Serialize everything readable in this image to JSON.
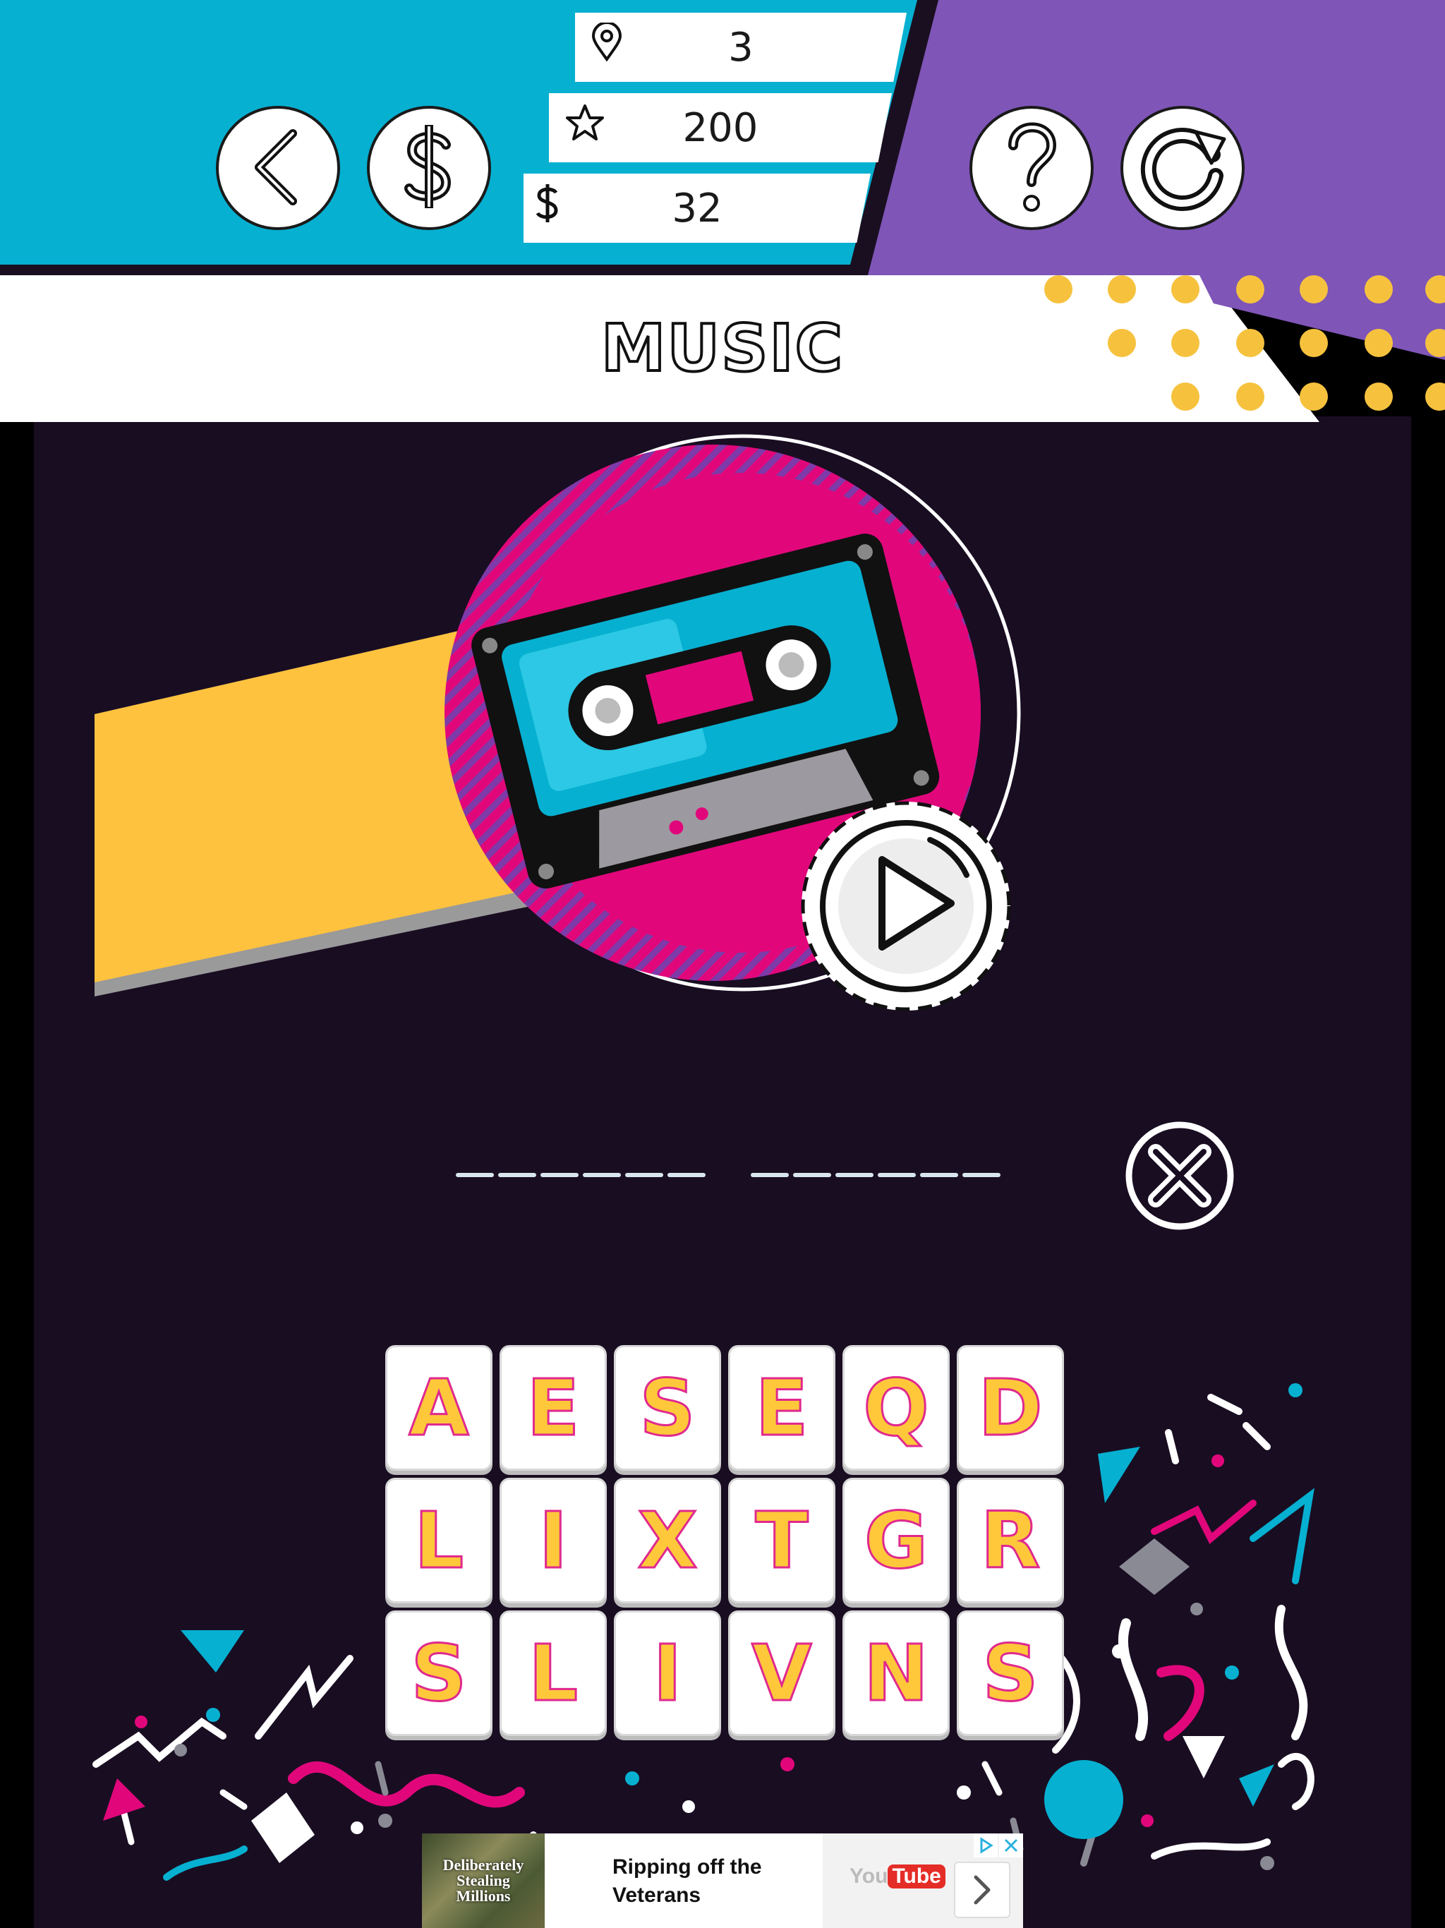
{
  "topbar": {
    "level": "3",
    "score": "200",
    "coins": "32"
  },
  "category_title": "MUSIC",
  "letters": [
    [
      "A",
      "E",
      "S",
      "E",
      "Q",
      "D"
    ],
    [
      "L",
      "I",
      "X",
      "T",
      "G",
      "R"
    ],
    [
      "S",
      "L",
      "I",
      "V",
      "N",
      "S"
    ]
  ],
  "answer": {
    "word_lengths": [
      6,
      6
    ]
  },
  "ad": {
    "image_text": "Deliberately Stealing Millions",
    "headline": "Ripping off the Veterans",
    "logo_text": "You",
    "logo_badge": "Tube"
  },
  "colors": {
    "cyan": "#06b0d1",
    "purple": "#7f55b8",
    "dark": "#190d22",
    "yellow": "#ffc23e",
    "magenta": "#e1077b",
    "tile_letter": "#ffc83a",
    "tile_outline": "#e0298e"
  },
  "icons": {
    "back": "chevron-left-icon",
    "shop": "dollar-icon",
    "help": "question-icon",
    "restart": "restart-icon",
    "level": "map-pin-icon",
    "score": "star-icon",
    "coins": "dollar-icon",
    "play": "play-icon",
    "clear": "close-icon"
  }
}
